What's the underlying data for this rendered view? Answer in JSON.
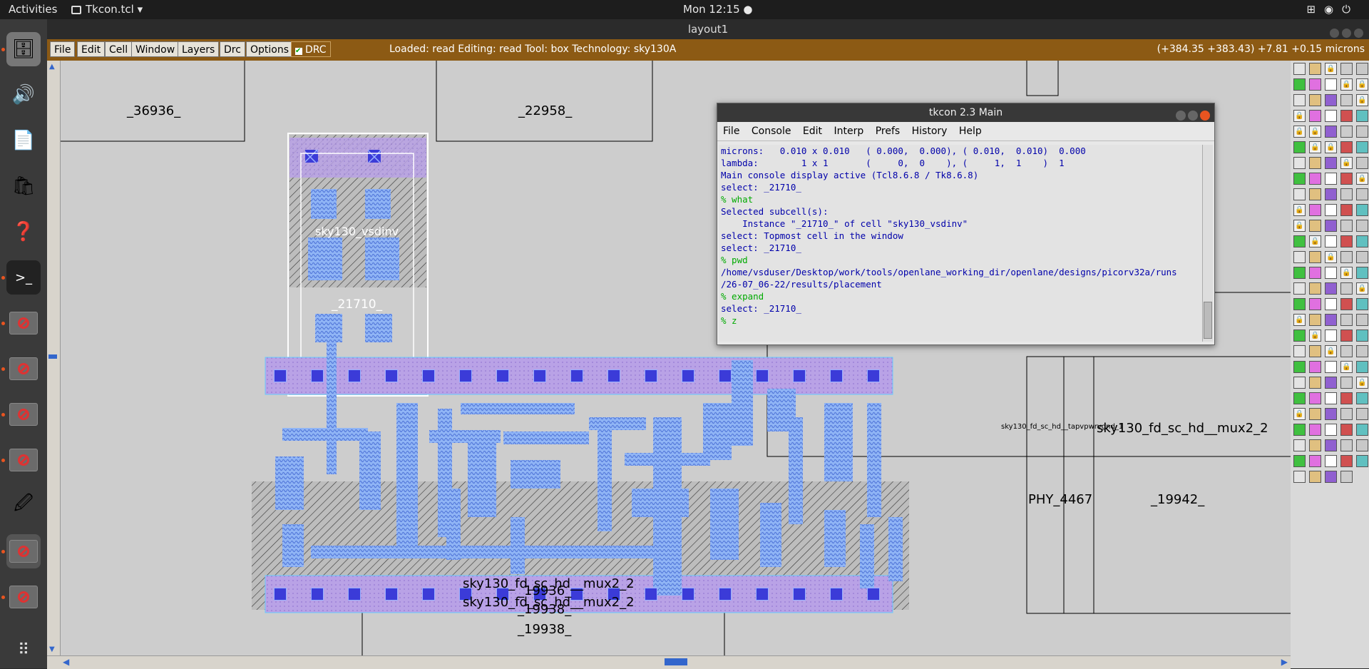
{
  "topbar": {
    "activities": "Activities",
    "app_name": "Tkcon.tcl",
    "clock": "Mon 12:15"
  },
  "window_title": "layout1",
  "menubar": {
    "items": [
      "File",
      "Edit",
      "Cell",
      "Window",
      "Layers",
      "Drc",
      "Options"
    ],
    "drc": "DRC",
    "status": "Loaded: read Editing: read Tool: box  Technology: sky130A",
    "coords": "(+384.35 +383.43) +7.81 +0.15 microns"
  },
  "layout": {
    "cells": [
      "_36936_",
      "_22958_",
      "sky130_vsdinv",
      "_21710_",
      "sky130_fd_sc_hd__tapvpwrvgnd_1",
      "sky130_fd_sc_hd__mux2_2",
      "PHY_4467",
      "_19942_",
      "sky130_fd_sc_hd__mux2_2",
      "_19936_",
      "sky130_fd_sc_hd__mux2_2",
      "_19938_",
      "_19938_"
    ]
  },
  "tkcon": {
    "title": "tkcon 2.3 Main",
    "menu": [
      "File",
      "Console",
      "Edit",
      "Interp",
      "Prefs",
      "History",
      "Help"
    ],
    "lines": [
      {
        "t": "out",
        "s": "microns:   0.010 x 0.010   ( 0.000,  0.000), ( 0.010,  0.010)  0.000"
      },
      {
        "t": "out",
        "s": "lambda:        1 x 1       (     0,  0    ), (     1,  1    )  1"
      },
      {
        "t": "out",
        "s": "Main console display active (Tcl8.6.8 / Tk8.6.8)"
      },
      {
        "t": "out",
        "s": "select: _21710_"
      },
      {
        "t": "cmd",
        "s": "% what"
      },
      {
        "t": "out",
        "s": "Selected subcell(s):"
      },
      {
        "t": "out",
        "s": "    Instance \"_21710_\" of cell \"sky130_vsdinv\""
      },
      {
        "t": "out",
        "s": "select: Topmost cell in the window"
      },
      {
        "t": "out",
        "s": "select: _21710_"
      },
      {
        "t": "cmd",
        "s": "% pwd"
      },
      {
        "t": "out",
        "s": "/home/vsduser/Desktop/work/tools/openlane_working_dir/openlane/designs/picorv32a/runs"
      },
      {
        "t": "out",
        "s": "/26-07_06-22/results/placement"
      },
      {
        "t": "cmd",
        "s": "% expand"
      },
      {
        "t": "out",
        "s": "select: _21710_"
      },
      {
        "t": "cmd",
        "s": "% z"
      }
    ]
  }
}
